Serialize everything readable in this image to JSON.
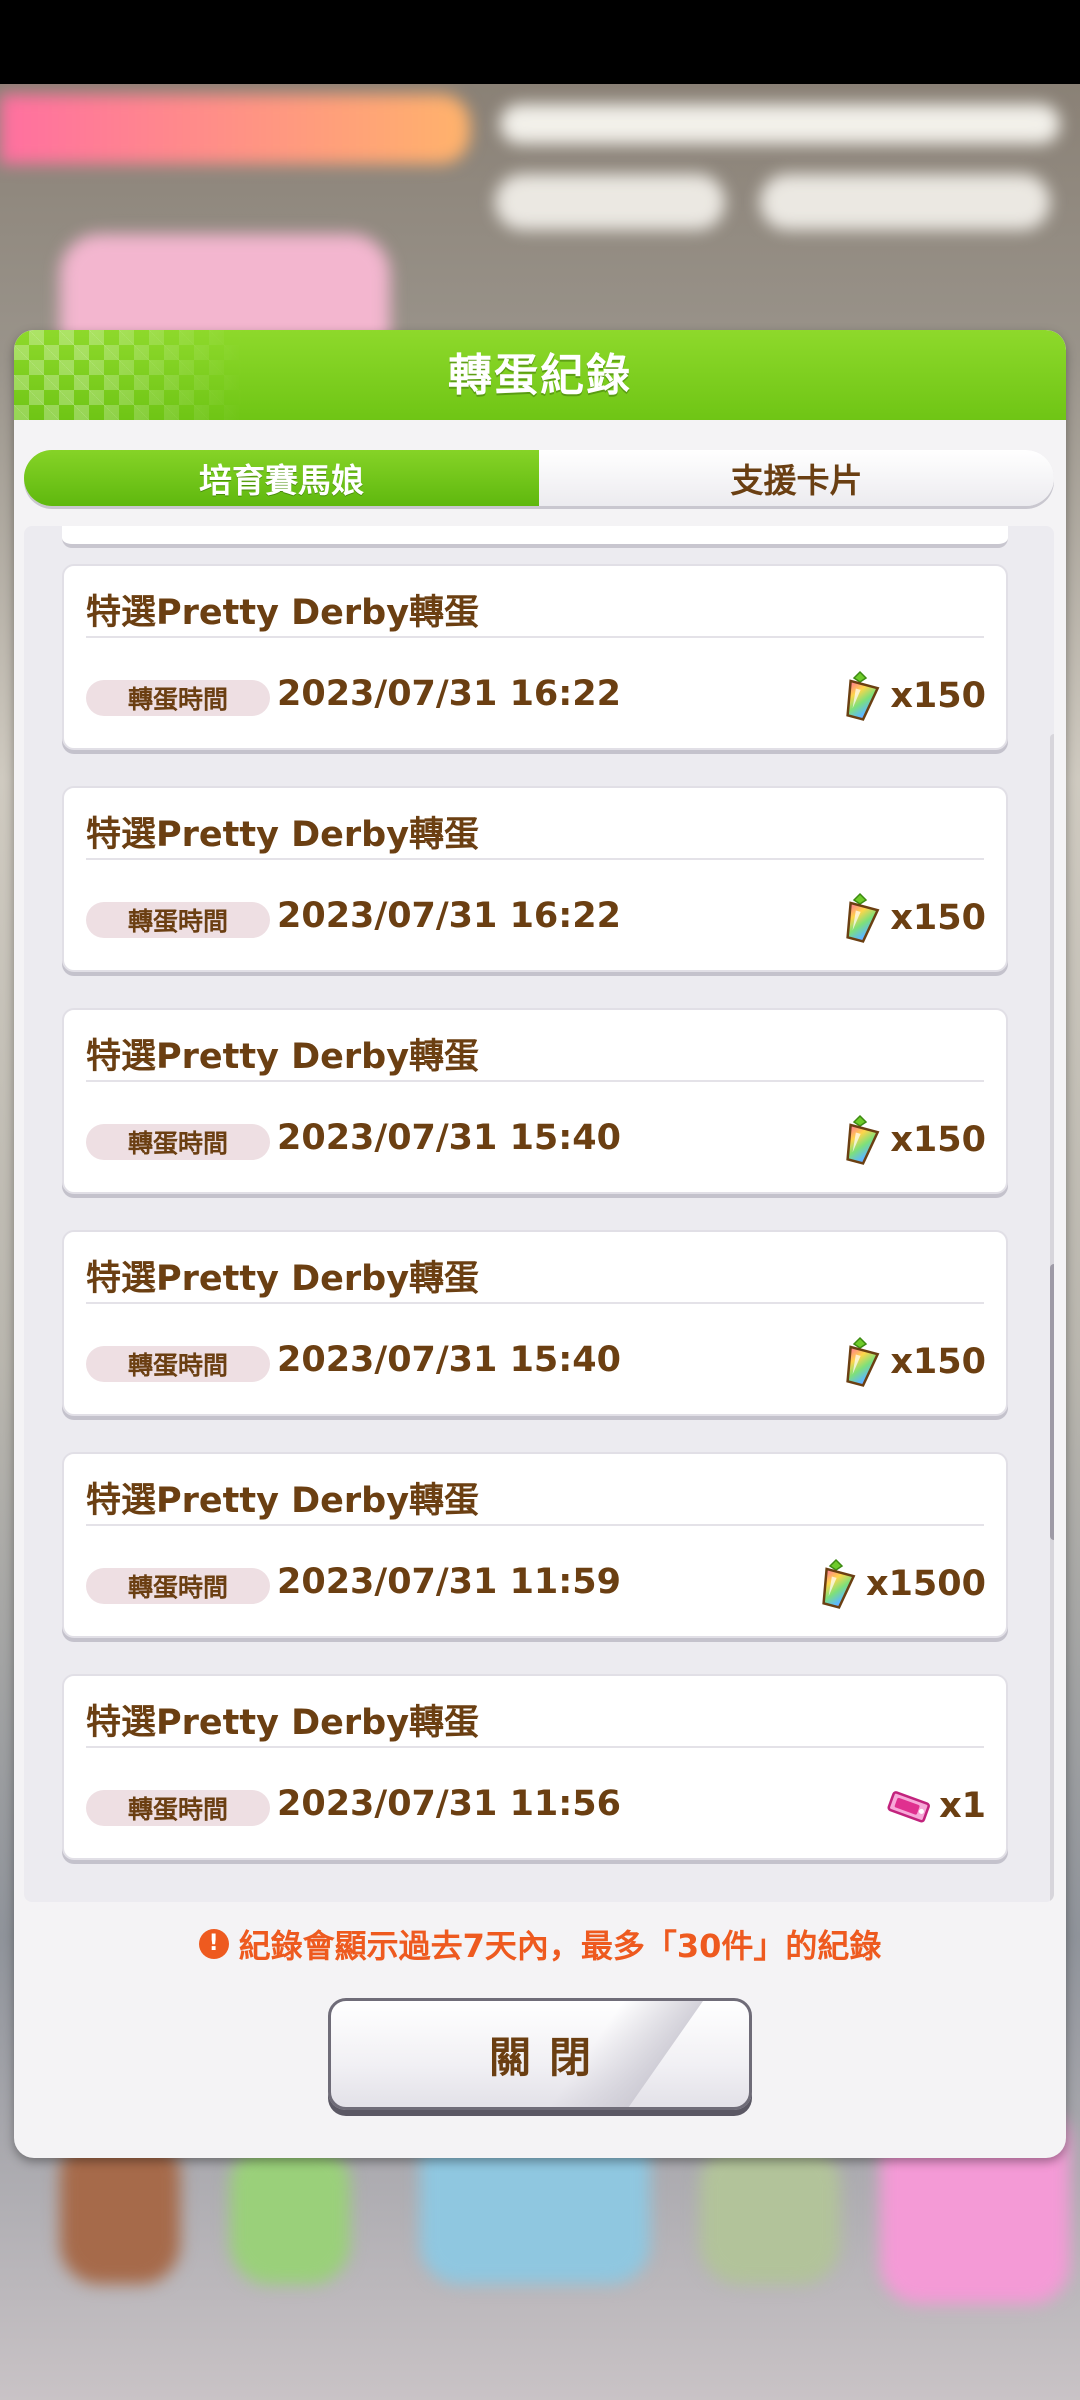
{
  "dialog": {
    "title": "轉蛋紀錄",
    "tabs": [
      {
        "label": "培育賽馬娘",
        "active": true
      },
      {
        "label": "支援卡片",
        "active": false
      }
    ],
    "time_badge_label": "轉蛋時間",
    "records": [
      {
        "title": "特選Pretty Derby轉蛋",
        "time": "2023/07/31 16:22",
        "cost_icon": "carat-gem-icon",
        "cost_qty": "x150"
      },
      {
        "title": "特選Pretty Derby轉蛋",
        "time": "2023/07/31 16:22",
        "cost_icon": "carat-gem-icon",
        "cost_qty": "x150"
      },
      {
        "title": "特選Pretty Derby轉蛋",
        "time": "2023/07/31 15:40",
        "cost_icon": "carat-gem-icon",
        "cost_qty": "x150"
      },
      {
        "title": "特選Pretty Derby轉蛋",
        "time": "2023/07/31 15:40",
        "cost_icon": "carat-gem-icon",
        "cost_qty": "x150"
      },
      {
        "title": "特選Pretty Derby轉蛋",
        "time": "2023/07/31 11:59",
        "cost_icon": "carat-gem-icon",
        "cost_qty": "x1500"
      },
      {
        "title": "特選Pretty Derby轉蛋",
        "time": "2023/07/31 11:56",
        "cost_icon": "gacha-ticket-icon",
        "cost_qty": "x1"
      }
    ],
    "notice": "紀錄會顯示過去7天內，最多「30件」的紀錄",
    "close_label": "關閉"
  },
  "colors": {
    "header_green": "#7ccd1c",
    "text_brown": "#6b3f12",
    "notice_orange": "#ee5a1f",
    "badge_pink": "#eedfe3"
  }
}
